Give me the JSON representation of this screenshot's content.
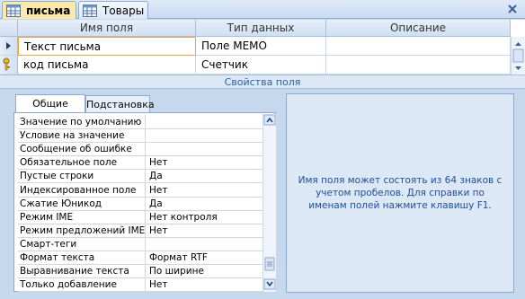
{
  "tabs": [
    {
      "label": "письма",
      "active": true
    },
    {
      "label": "Товары",
      "active": false
    }
  ],
  "grid": {
    "headers": [
      "Имя поля",
      "Тип данных",
      "Описание"
    ],
    "rows": [
      {
        "name": "Текст письма",
        "type": "Поле MEMO",
        "description": "",
        "key": false,
        "selected": true
      },
      {
        "name": "код письма",
        "type": "Счетчик",
        "description": "",
        "key": true,
        "selected": false
      }
    ]
  },
  "properties_title": "Свойства поля",
  "prop_tabs": [
    "Общие",
    "Подстановка"
  ],
  "properties": [
    {
      "name": "Значение по умолчанию",
      "value": ""
    },
    {
      "name": "Условие на значение",
      "value": ""
    },
    {
      "name": "Сообщение об ошибке",
      "value": ""
    },
    {
      "name": "Обязательное поле",
      "value": "Нет"
    },
    {
      "name": "Пустые строки",
      "value": "Да"
    },
    {
      "name": "Индексированное поле",
      "value": "Нет"
    },
    {
      "name": "Сжатие Юникод",
      "value": "Да"
    },
    {
      "name": "Режим IME",
      "value": "Нет контроля"
    },
    {
      "name": "Режим предложений IME",
      "value": "Нет"
    },
    {
      "name": "Смарт-теги",
      "value": ""
    },
    {
      "name": "Формат текста",
      "value": "Формат RTF"
    },
    {
      "name": "Выравнивание текста",
      "value": "По ширине"
    },
    {
      "name": "Только добавление",
      "value": "Нет"
    }
  ],
  "help_text": "Имя поля может состоять из 64 знаков с учетом пробелов.  Для справки по именам полей нажмите клавишу F1."
}
